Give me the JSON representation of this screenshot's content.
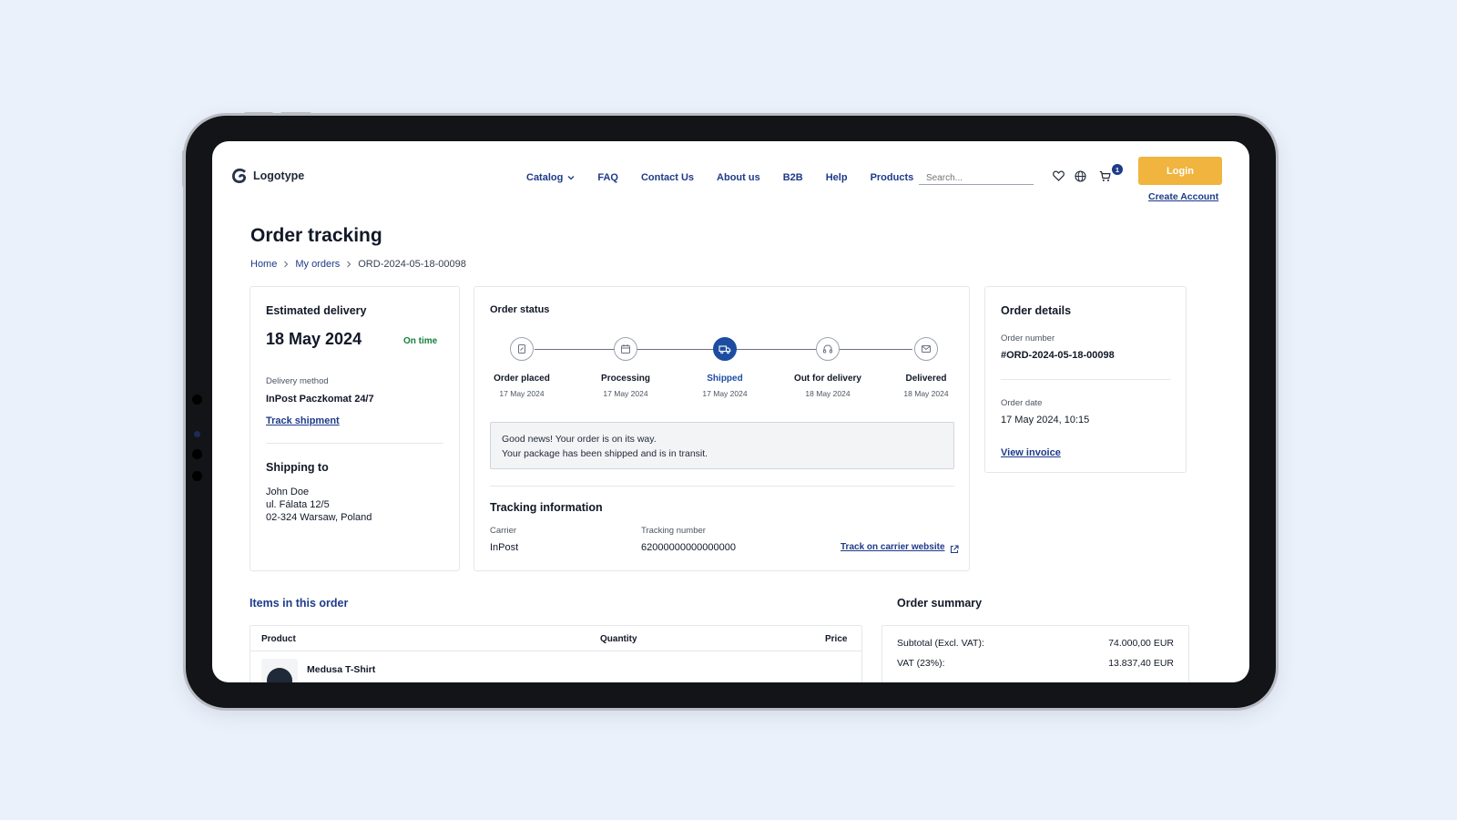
{
  "header": {
    "logo_text": "Logotype",
    "nav": [
      "Catalog",
      "FAQ",
      "Contact Us",
      "About us",
      "B2B",
      "Help",
      "Products"
    ],
    "search_placeholder": "Search...",
    "cart_count": "1",
    "login_label": "Login",
    "create_account_label": "Create Account"
  },
  "page": {
    "title": "Order tracking",
    "breadcrumb": [
      "Home",
      "My orders",
      "ORD-2024-05-18-00098"
    ]
  },
  "delivery": {
    "heading": "Estimated delivery",
    "date": "18 May 2024",
    "status": "On time",
    "method_label": "Delivery method",
    "method_value": "InPost Paczkomat 24/7",
    "track_link": "Track shipment",
    "shipping_heading": "Shipping to",
    "address": [
      "John Doe",
      "ul. Fálata 12/5",
      "02-324 Warsaw, Poland"
    ]
  },
  "order_status": {
    "heading": "Order status",
    "steps": [
      {
        "name": "Order placed",
        "date": "17 May 2024",
        "icon": "receipt-icon"
      },
      {
        "name": "Processing",
        "date": "17 May 2024",
        "icon": "calendar-icon"
      },
      {
        "name": "Shipped",
        "date": "17 May 2024",
        "icon": "truck-icon"
      },
      {
        "name": "Out for delivery",
        "date": "18 May 2024",
        "icon": "headphones-icon"
      },
      {
        "name": "Delivered",
        "date": "18 May 2024",
        "icon": "mail-icon"
      }
    ],
    "active_step": "Shipped",
    "notice_line1": "Good news! Your order is on its way.",
    "notice_line2": "Your package has been shipped and is in transit.",
    "tracking_heading": "Tracking information",
    "carrier_label": "Carrier",
    "carrier_value": "InPost",
    "tracking_label": "Tracking number",
    "tracking_value": "62000000000000000",
    "carrier_link": "Track on carrier website"
  },
  "order_details": {
    "heading": "Order details",
    "number_label": "Order number",
    "number_value": "#ORD-2024-05-18-00098",
    "date_label": "Order date",
    "date_value": "17 May 2024, 10:15",
    "invoice_link": "View invoice"
  },
  "items": {
    "heading": "Items in this order",
    "columns": [
      "Product",
      "Quantity",
      "Price"
    ],
    "rows": [
      {
        "product": "Medusa T-Shirt"
      }
    ]
  },
  "summary": {
    "heading": "Order summary",
    "rows": [
      {
        "label": "Subtotal (Excl. VAT):",
        "value": "74.000,00 EUR"
      },
      {
        "label": "VAT (23%):",
        "value": "13.837,40 EUR"
      }
    ]
  },
  "colors": {
    "background": "#eaf1fb",
    "primary_blue": "#1e3a8a",
    "active_step": "#1d4da1",
    "login_button": "#f0b43f",
    "on_time_green": "#15803d"
  }
}
